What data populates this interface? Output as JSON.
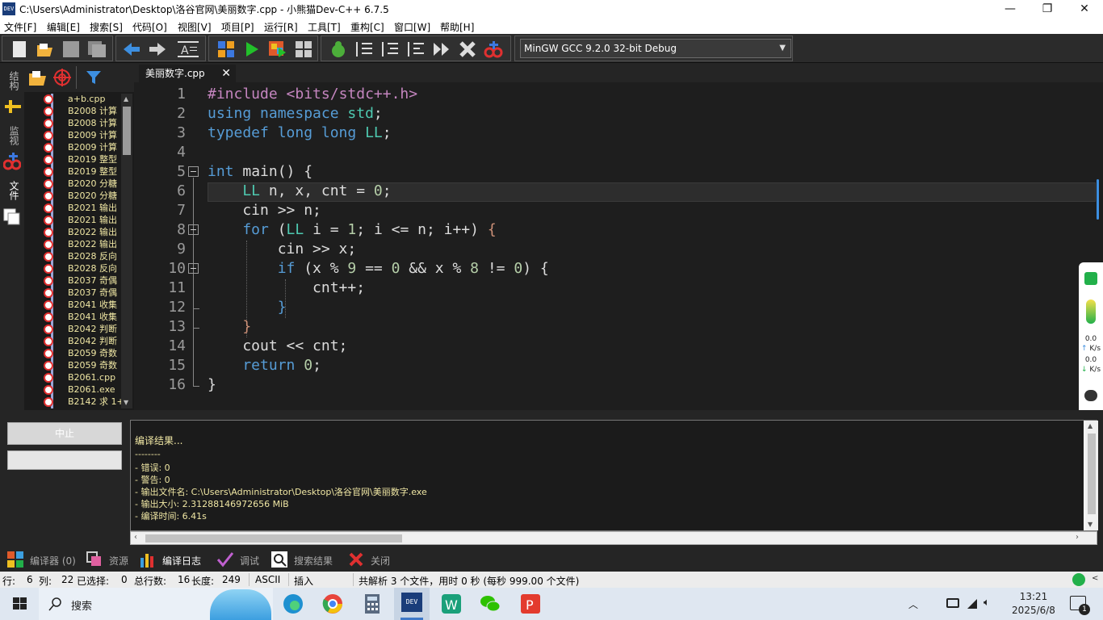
{
  "window": {
    "title": "C:\\Users\\Administrator\\Desktop\\洛谷官网\\美丽数字.cpp - 小熊猫Dev-C++ 6.7.5",
    "app_icon_text": "DEV",
    "minimize": "—",
    "maximize": "❐",
    "close": "✕"
  },
  "menu": [
    "文件[F]",
    "编辑[E]",
    "搜索[S]",
    "代码[O]",
    "视图[V]",
    "项目[P]",
    "运行[R]",
    "工具[T]",
    "重构[C]",
    "窗口[W]",
    "帮助[H]"
  ],
  "toolbar": {
    "compiler": "MinGW GCC 9.2.0 32-bit Debug",
    "icons": [
      "new-file-icon",
      "open-folder-icon",
      "save-icon",
      "save-all-icon",
      "back-arrow-icon",
      "forward-arrow-icon",
      "format-code-icon",
      "compile-icon",
      "run-icon",
      "compile-run-icon",
      "rebuild-icon",
      "debug-icon",
      "step-over-icon",
      "step-into-icon",
      "step-out-icon",
      "continue-icon",
      "stop-icon",
      "add-watch-icon"
    ]
  },
  "left_tabs": [
    "结构",
    "监视",
    "文件"
  ],
  "project_files": [
    "a+b.cpp",
    "B2008 计算",
    "B2008 计算",
    "B2009 计算",
    "B2009 计算",
    "B2019 整型",
    "B2019 整型",
    "B2020 分糖",
    "B2020 分糖",
    "B2021 输出",
    "B2021 输出",
    "B2022 输出",
    "B2022 输出",
    "B2028 反向",
    "B2028 反向",
    "B2037 奇偶",
    "B2037 奇偶",
    "B2041 收集",
    "B2041 收集",
    "B2042 判断",
    "B2042 判断",
    "B2059 奇数",
    "B2059 奇数",
    "B2061.cpp",
    "B2061.exe",
    "B2142 求 1+"
  ],
  "editor": {
    "tab_label": "美丽数字.cpp",
    "tab_close": "✕",
    "line_numbers": [
      "1",
      "2",
      "3",
      "4",
      "5",
      "6",
      "7",
      "8",
      "9",
      "10",
      "11",
      "12",
      "13",
      "14",
      "15",
      "16"
    ],
    "code": {
      "l1_a": "#include ",
      "l1_b": "<bits/stdc++.h>",
      "l2_a": "using namespace ",
      "l2_b": "std",
      "l2_c": ";",
      "l3_a": "typedef long long ",
      "l3_b": "LL",
      "l3_c": ";",
      "l5_a": "int ",
      "l5_b": "main() {",
      "l6_a": "    LL ",
      "l6_b": "n, x, cnt = ",
      "l6_c": "0",
      "l6_d": ";",
      "l7_a": "    cin >> n;",
      "l8_a": "    for ",
      "l8_b": "(",
      "l8_c": "LL ",
      "l8_d": "i = ",
      "l8_e": "1",
      "l8_f": "; i <= n; i++) ",
      "l8_g": "{",
      "l9_a": "        cin >> x;",
      "l10_a": "        if ",
      "l10_b": "(x % ",
      "l10_c": "9",
      "l10_d": " == ",
      "l10_e": "0",
      "l10_f": " && x % ",
      "l10_g": "8",
      "l10_h": " != ",
      "l10_i": "0",
      "l10_j": ") {",
      "l11_a": "            cnt++;",
      "l12_a": "        }",
      "l13_a": "    }",
      "l14_a": "    cout << cnt;",
      "l15_a": "    return ",
      "l15_b": "0",
      "l15_c": ";",
      "l16_a": "}"
    }
  },
  "right_widget": {
    "upload_value": "0.0",
    "upload_unit": "K/s",
    "download_value": "0.0",
    "download_unit": "K/s"
  },
  "bottom": {
    "stop_button": "中止",
    "log": [
      "编译结果...",
      "--------",
      "- 错误: 0",
      "- 警告: 0",
      "- 输出文件名: C:\\Users\\Administrator\\Desktop\\洛谷官网\\美丽数字.exe",
      "- 输出大小: 2.31288146972656 MiB",
      "- 编译时间: 6.41s"
    ],
    "tabs": [
      "编译器 (0)",
      "资源",
      "编译日志",
      "调试",
      "搜索结果",
      "关闭"
    ]
  },
  "status": {
    "row_label": "行:",
    "row_value": "6",
    "col_label": "列:",
    "col_value": "22",
    "sel_label": "已选择:",
    "sel_value": "0",
    "total_label": "总行数:",
    "total_value": "16",
    "len_label": "长度:",
    "len_value": "249",
    "encoding": "ASCII",
    "mode": "插入",
    "parse_info": "共解析 3 个文件，用时 0 秒 (每秒 999.00 个文件)"
  },
  "taskbar": {
    "search": "搜索",
    "time": "13:21",
    "date": "2025/6/8",
    "notification_count": "1"
  },
  "colors": {
    "keyword": "#569cd6",
    "number": "#b5cea8",
    "preprocessor": "#c586c0",
    "type": "#4ec9b0",
    "log_text": "#f0e7a4"
  }
}
